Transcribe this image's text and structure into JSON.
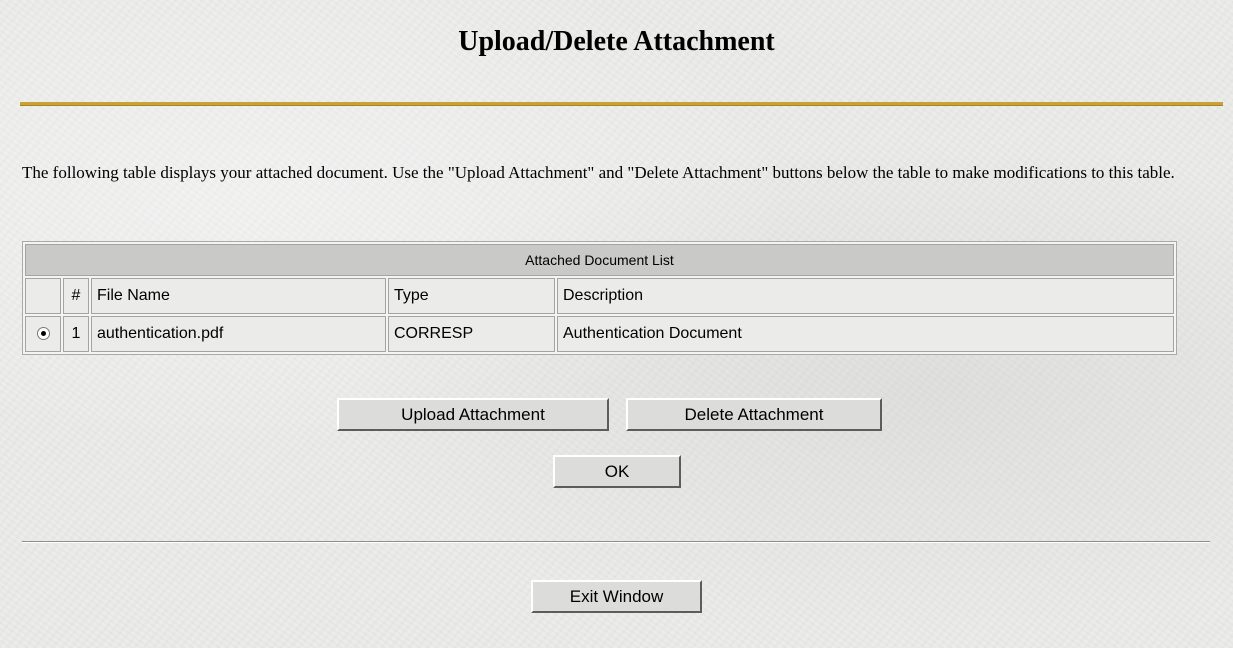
{
  "page": {
    "title": "Upload/Delete Attachment",
    "instructions": "The following table displays your attached document.  Use the \"Upload Attachment\" and \"Delete Attachment\" buttons below the table to make modifications to this table."
  },
  "table": {
    "caption": "Attached Document List",
    "columns": [
      "",
      "#",
      "File Name",
      "Type",
      "Description"
    ],
    "rows": [
      {
        "selected": true,
        "number": "1",
        "file_name": "authentication.pdf",
        "type": "CORRESP",
        "description": "Authentication Document"
      }
    ]
  },
  "buttons": {
    "upload": "Upload Attachment",
    "delete": "Delete Attachment",
    "ok": "OK",
    "exit": "Exit Window"
  },
  "colors": {
    "title_rule": "#c9a135",
    "background": "#ececeb"
  }
}
